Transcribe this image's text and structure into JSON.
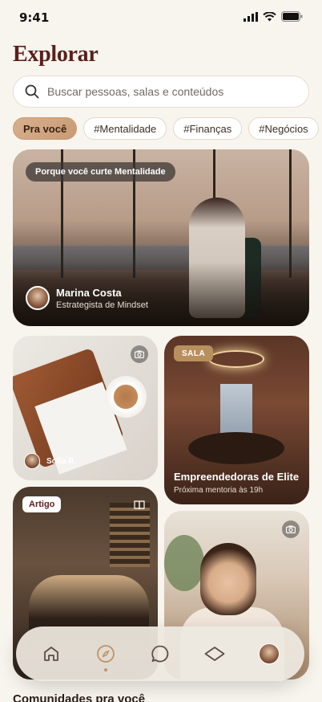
{
  "status_bar": {
    "time": "9:41"
  },
  "header": {
    "title": "Explorar"
  },
  "search": {
    "placeholder": "Buscar pessoas, salas e conteúdos"
  },
  "chips": [
    "Pra você",
    "#Mentalidade",
    "#Finanças",
    "#Negócios"
  ],
  "hero": {
    "tag": "Porque você curte Mentalidade",
    "author_name": "Marina Costa",
    "author_role": "Estrategista de Mindset"
  },
  "card_notebook": {
    "author_name": "Sofia R."
  },
  "card_sala": {
    "badge": "SALA",
    "title": "Empreendedoras de Elite",
    "subtitle": "Próxima mentoria às 19h"
  },
  "card_bar": {
    "badge": "Artigo"
  },
  "bottom_nav": {
    "items": [
      "home-icon",
      "compass-icon",
      "chat-icon",
      "diamond-icon",
      "profile-avatar"
    ],
    "active": "compass-icon"
  },
  "section": {
    "title": "Comunidades pra você"
  },
  "colors": {
    "accent": "#c09466",
    "title": "#5a1f1c",
    "background": "#f8f4ee"
  }
}
